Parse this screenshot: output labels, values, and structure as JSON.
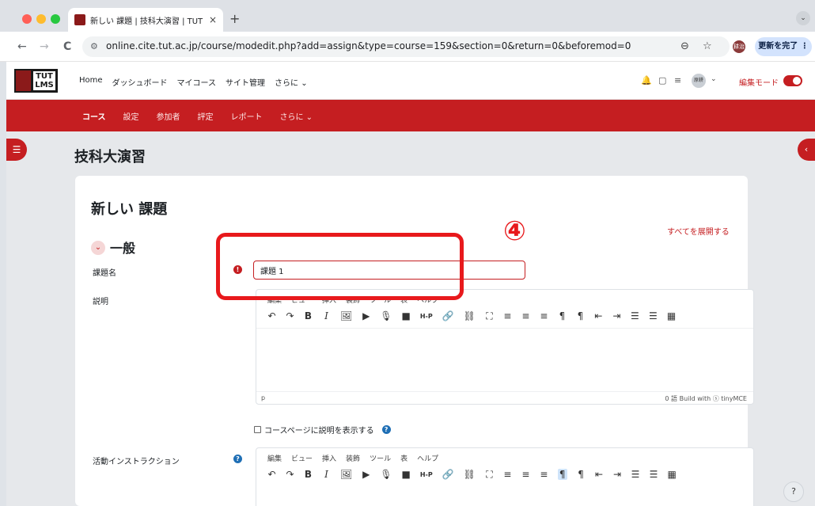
{
  "browser": {
    "tab_title": "新しい 課題 | 技科大演習 | TUT L",
    "tab_close": "×",
    "new_tab": "+",
    "tab_menu": "⌄",
    "back": "←",
    "forward": "→",
    "reload": "C",
    "site_info": "⚙",
    "url": "online.cite.tut.ac.jp/course/modedit.php?add=assign&type=course=159&section=0&return=0&beforemod=0",
    "zoom_icon": "⊖",
    "star_icon": "☆",
    "profile_label": "耕治",
    "update_button": "更新を完了 ⋮"
  },
  "header": {
    "logo_text": "TUT LMS",
    "nav": [
      "Home",
      "ダッシュボード",
      "マイコース",
      "サイト管理",
      "さらに ⌄"
    ],
    "bell_icon": "🔔",
    "chat_icon": "▢",
    "db_icon": "≡",
    "user_name": "原耕",
    "user_chevron": "⌄",
    "edit_mode_label": "編集モード"
  },
  "course_nav": {
    "items": [
      "コース",
      "設定",
      "参加者",
      "評定",
      "レポート",
      "さらに ⌄"
    ]
  },
  "drawer_left_icon": "☰",
  "drawer_right_icon": "‹",
  "page": {
    "course_title": "技科大演習",
    "form_title": "新しい 課題",
    "expand_all": "すべてを展開する",
    "section_toggle": "⌄",
    "section_title": "一般",
    "name_label": "課題名",
    "required_icon": "!",
    "name_value": "課題 1",
    "description_label": "説明",
    "show_description": "コースページに説明を表示する",
    "help_icon": "?",
    "activity_label": "活動インストラクション"
  },
  "editor": {
    "menu": [
      "編集",
      "ビュー",
      "挿入",
      "装飾",
      "ツール",
      "表",
      "ヘルプ"
    ],
    "toolbar": [
      "↶",
      "↷",
      "B",
      "I",
      "🖼",
      "▶",
      "🎙",
      "■",
      "H-P",
      "🔗",
      "⛓",
      "⛶",
      "≡",
      "≡",
      "≡",
      "¶",
      "¶",
      "⇤",
      "⇥",
      "☰",
      "☰",
      "▦"
    ],
    "status_path": "p",
    "status_right": "0 語   Build with ⓢ tinyMCE"
  },
  "annotation": {
    "number": "④",
    "color": "#e8191c"
  },
  "floating_help": "?",
  "colors": {
    "accent": "#c51e21",
    "annotation": "#e8191c"
  }
}
